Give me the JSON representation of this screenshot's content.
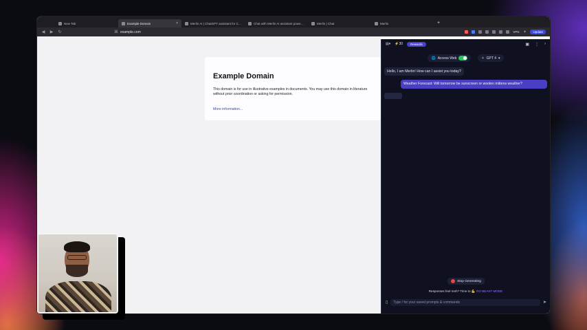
{
  "browser": {
    "tabs": [
      {
        "label": "New Tab",
        "active": false
      },
      {
        "label": "Example Domain",
        "active": true
      },
      {
        "label": "Merlin AI | ChatGPT assistant for C…",
        "active": false
      },
      {
        "label": "Chat with Merlin AI assistant powe…",
        "active": false
      },
      {
        "label": "Merlin | Chat",
        "active": false
      },
      {
        "label": "Merlin",
        "active": false
      }
    ],
    "new_tab_glyph": "+",
    "close_glyph": "×",
    "url": "example.com",
    "vpn_label": "VPN",
    "update_label": "Update"
  },
  "page": {
    "title": "Example Domain",
    "body": "This domain is for use in illustrative examples in documents. You may use this domain in literature without prior coordination or asking for permission.",
    "link": "More information..."
  },
  "merlin": {
    "points": "30",
    "rewards_label": "Rewards",
    "access_web_label": "Access Web",
    "access_web_on": true,
    "model_label": "GPT 4",
    "bot_greeting": "Hello, I am Merlin! How can I assist you today?",
    "user_message": "Weather Forecast: Will tomorrow be sunscreen or woolen mittens weather?",
    "stop_label": "Stop Generating",
    "beast_prefix": "Responses feel meh? Time to 💪",
    "beast_link": "GO BEAST MODE",
    "input_placeholder": "Type / for your saved prompts & commands"
  },
  "colors": {
    "accent": "#4a3fc4",
    "toggle_on": "#22c55e",
    "stop": "#ef4444",
    "sidebar_bg": "#0f1120"
  }
}
